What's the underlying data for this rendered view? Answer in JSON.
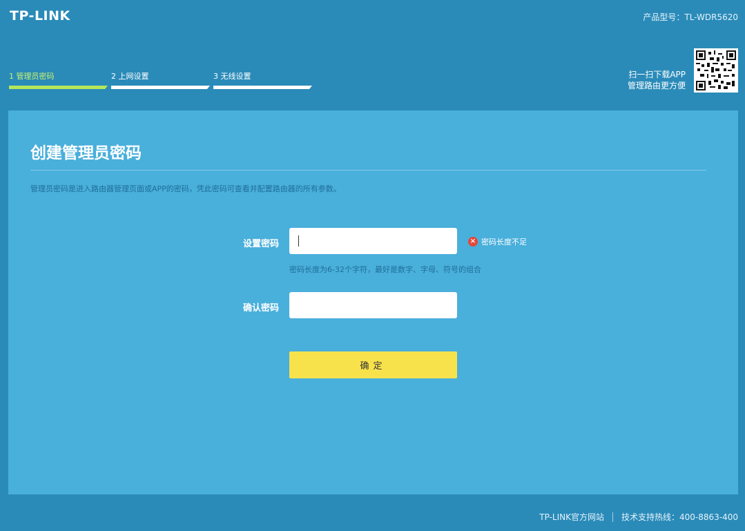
{
  "header": {
    "logo": "TP-LINK",
    "model": "产品型号：TL-WDR5620"
  },
  "steps": [
    {
      "label": "1 管理员密码",
      "active": true
    },
    {
      "label": "2 上网设置",
      "active": false
    },
    {
      "label": "3 无线设置",
      "active": false
    }
  ],
  "app_promo": {
    "line1": "扫一扫下载APP",
    "line2": "管理路由更方便"
  },
  "panel": {
    "title": "创建管理员密码",
    "description": "管理员密码是进入路由器管理页面或APP的密码，凭此密码可查看并配置路由器的所有参数。",
    "password": {
      "label": "设置密码",
      "value": "",
      "error": "密码长度不足",
      "hint": "密码长度为6-32个字符，最好是数字、字母、符号的组合"
    },
    "confirm": {
      "label": "确认密码",
      "value": ""
    },
    "submit_label": "确定"
  },
  "footer": {
    "site": "TP-LINK官方网站",
    "support": "技术支持热线：400-8863-400"
  },
  "colors": {
    "background": "#2a8bb9",
    "panel": "#49afdb",
    "active_step": "#b6e65a",
    "button": "#f8e24c",
    "error": "#e2493b"
  }
}
